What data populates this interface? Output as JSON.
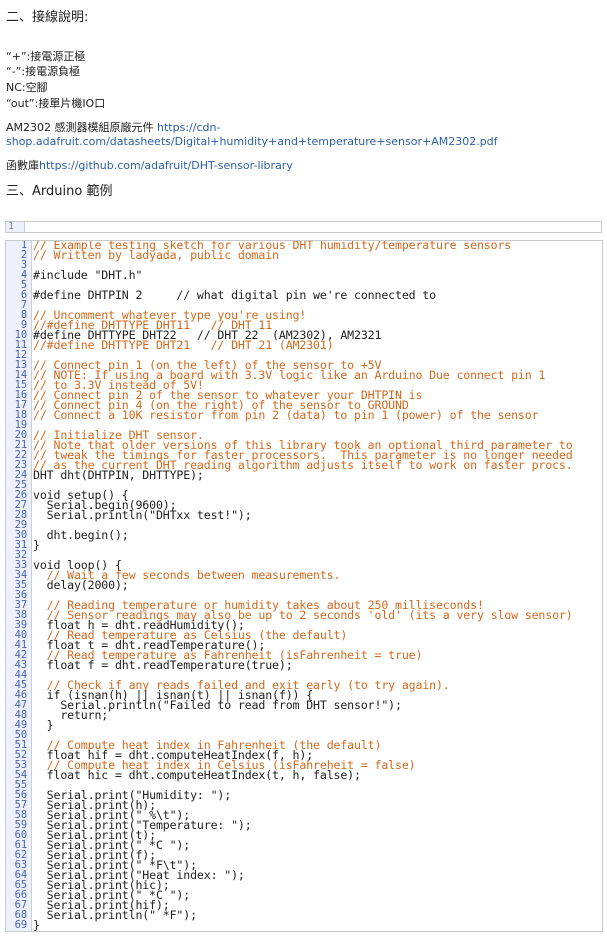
{
  "section2_title": "二、接線說明:",
  "pins": [
    "“+”:接電源正極",
    "“-”:接電源負極",
    "NC:空腳",
    "“out”:接單片機IO口"
  ],
  "component_text": "AM2302 感測器模組原廠元件 ",
  "component_link_line1": "https://cdn-",
  "component_link_line2": "shop.adafruit.com/datasheets/Digital+humidity+and+temperature+sensor+AM2302.pdf",
  "library_text": "函數庫",
  "library_link": "https://github.com/adafruit/DHT-sensor-library",
  "section3_title": "三、Arduino 範例",
  "snippet_line_number": "1",
  "code_lines": [
    {
      "n": "1",
      "t": "// Example testing sketch for various DHT humidity/temperature sensors",
      "c": true
    },
    {
      "n": "2",
      "t": "// Written by ladyada, public domain",
      "c": true
    },
    {
      "n": "3",
      "t": "",
      "c": false
    },
    {
      "n": "4",
      "t": "#include \"DHT.h\"",
      "c": false
    },
    {
      "n": "5",
      "t": "",
      "c": false
    },
    {
      "n": "6",
      "t": "#define DHTPIN 2     // what digital pin we're connected to",
      "c": false
    },
    {
      "n": "7",
      "t": "",
      "c": false
    },
    {
      "n": "8",
      "t": "// Uncomment whatever type you're using!",
      "c": true
    },
    {
      "n": "9",
      "t": "//#define DHTTYPE DHT11   // DHT 11",
      "c": true
    },
    {
      "n": "10",
      "t": "#define DHTTYPE DHT22   // DHT 22  (AM2302), AM2321",
      "c": false
    },
    {
      "n": "11",
      "t": "//#define DHTTYPE DHT21   // DHT 21 (AM2301)",
      "c": true
    },
    {
      "n": "12",
      "t": "",
      "c": false
    },
    {
      "n": "13",
      "t": "// Connect pin 1 (on the left) of the sensor to +5V",
      "c": true
    },
    {
      "n": "14",
      "t": "// NOTE: If using a board with 3.3V logic like an Arduino Due connect pin 1",
      "c": true
    },
    {
      "n": "15",
      "t": "// to 3.3V instead of 5V!",
      "c": true
    },
    {
      "n": "16",
      "t": "// Connect pin 2 of the sensor to whatever your DHTPIN is",
      "c": true
    },
    {
      "n": "17",
      "t": "// Connect pin 4 (on the right) of the sensor to GROUND",
      "c": true
    },
    {
      "n": "18",
      "t": "// Connect a 10K resistor from pin 2 (data) to pin 1 (power) of the sensor",
      "c": true
    },
    {
      "n": "19",
      "t": "",
      "c": false
    },
    {
      "n": "20",
      "t": "// Initialize DHT sensor.",
      "c": true
    },
    {
      "n": "21",
      "t": "// Note that older versions of this library took an optional third parameter to",
      "c": true
    },
    {
      "n": "22",
      "t": "// tweak the timings for faster processors.  This parameter is no longer needed",
      "c": true
    },
    {
      "n": "23",
      "t": "// as the current DHT reading algorithm adjusts itself to work on faster procs.",
      "c": true
    },
    {
      "n": "24",
      "t": "DHT dht(DHTPIN, DHTTYPE);",
      "c": false
    },
    {
      "n": "25",
      "t": "",
      "c": false
    },
    {
      "n": "26",
      "t": "void setup() {",
      "c": false
    },
    {
      "n": "27",
      "t": "  Serial.begin(9600);",
      "c": false
    },
    {
      "n": "28",
      "t": "  Serial.println(\"DHTxx test!\");",
      "c": false
    },
    {
      "n": "29",
      "t": "",
      "c": false
    },
    {
      "n": "30",
      "t": "  dht.begin();",
      "c": false
    },
    {
      "n": "31",
      "t": "}",
      "c": false
    },
    {
      "n": "32",
      "t": "",
      "c": false
    },
    {
      "n": "33",
      "t": "void loop() {",
      "c": false
    },
    {
      "n": "34",
      "t": "  // Wait a few seconds between measurements.",
      "c": true
    },
    {
      "n": "35",
      "t": "  delay(2000);",
      "c": false
    },
    {
      "n": "36",
      "t": "",
      "c": false
    },
    {
      "n": "37",
      "t": "  // Reading temperature or humidity takes about 250 milliseconds!",
      "c": true
    },
    {
      "n": "38",
      "t": "  // Sensor readings may also be up to 2 seconds 'old' (its a very slow sensor)",
      "c": true
    },
    {
      "n": "39",
      "t": "  float h = dht.readHumidity();",
      "c": false
    },
    {
      "n": "40",
      "t": "  // Read temperature as Celsius (the default)",
      "c": true
    },
    {
      "n": "41",
      "t": "  float t = dht.readTemperature();",
      "c": false
    },
    {
      "n": "42",
      "t": "  // Read temperature as Fahrenheit (isFahrenheit = true)",
      "c": true
    },
    {
      "n": "43",
      "t": "  float f = dht.readTemperature(true);",
      "c": false
    },
    {
      "n": "44",
      "t": "",
      "c": false
    },
    {
      "n": "45",
      "t": "  // Check if any reads failed and exit early (to try again).",
      "c": true
    },
    {
      "n": "46",
      "t": "  if (isnan(h) || isnan(t) || isnan(f)) {",
      "c": false
    },
    {
      "n": "47",
      "t": "    Serial.println(\"Failed to read from DHT sensor!\");",
      "c": false
    },
    {
      "n": "48",
      "t": "    return;",
      "c": false
    },
    {
      "n": "49",
      "t": "  }",
      "c": false
    },
    {
      "n": "50",
      "t": "",
      "c": false
    },
    {
      "n": "51",
      "t": "  // Compute heat index in Fahrenheit (the default)",
      "c": true
    },
    {
      "n": "52",
      "t": "  float hif = dht.computeHeatIndex(f, h);",
      "c": false
    },
    {
      "n": "53",
      "t": "  // Compute heat index in Celsius (isFahreheit = false)",
      "c": true
    },
    {
      "n": "54",
      "t": "  float hic = dht.computeHeatIndex(t, h, false);",
      "c": false
    },
    {
      "n": "55",
      "t": "",
      "c": false
    },
    {
      "n": "56",
      "t": "  Serial.print(\"Humidity: \");",
      "c": false
    },
    {
      "n": "57",
      "t": "  Serial.print(h);",
      "c": false
    },
    {
      "n": "58",
      "t": "  Serial.print(\" %\\t\");",
      "c": false
    },
    {
      "n": "59",
      "t": "  Serial.print(\"Temperature: \");",
      "c": false
    },
    {
      "n": "60",
      "t": "  Serial.print(t);",
      "c": false
    },
    {
      "n": "61",
      "t": "  Serial.print(\" *C \");",
      "c": false
    },
    {
      "n": "62",
      "t": "  Serial.print(f);",
      "c": false
    },
    {
      "n": "63",
      "t": "  Serial.print(\" *F\\t\");",
      "c": false
    },
    {
      "n": "64",
      "t": "  Serial.print(\"Heat index: \");",
      "c": false
    },
    {
      "n": "65",
      "t": "  Serial.print(hic);",
      "c": false
    },
    {
      "n": "66",
      "t": "  Serial.print(\" *C \");",
      "c": false
    },
    {
      "n": "67",
      "t": "  Serial.print(hif);",
      "c": false
    },
    {
      "n": "68",
      "t": "  Serial.println(\" *F\");",
      "c": false
    },
    {
      "n": "69",
      "t": "}",
      "c": false
    }
  ]
}
